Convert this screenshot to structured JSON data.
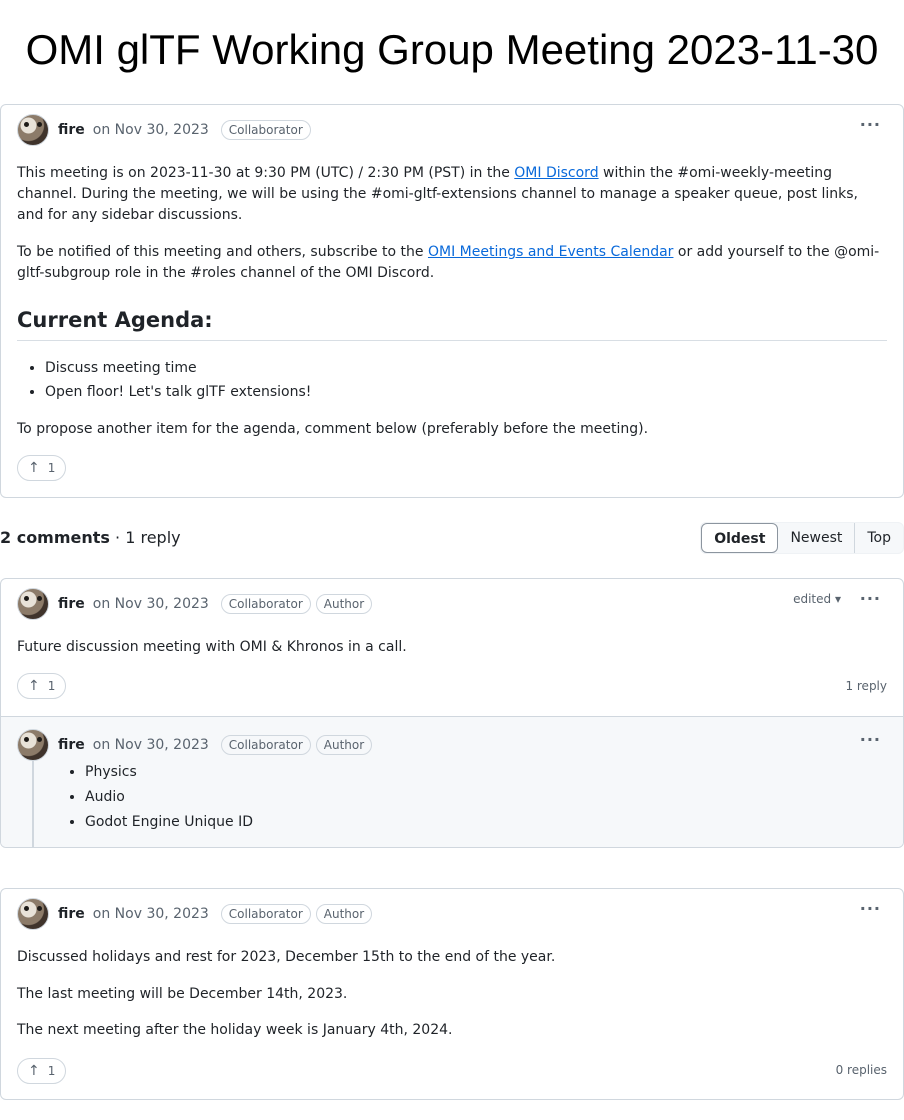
{
  "page_title": "OMI glTF Working Group Meeting 2023-11-30",
  "post": {
    "author": "fire",
    "date": "on Nov 30, 2023",
    "badge": "Collaborator",
    "para1_a": "This meeting is on 2023-11-30 at 9:30 PM (UTC) / 2:30 PM (PST) in the ",
    "para1_link": "OMI Discord",
    "para1_b": " within the #omi-weekly-meeting channel. During the meeting, we will be using the #omi-gltf-extensions channel to manage a speaker queue, post links, and for any sidebar discussions.",
    "para2_a": "To be notified of this meeting and others, subscribe to the ",
    "para2_link": "OMI Meetings and Events Calendar",
    "para2_b": " or add yourself to the @omi-gltf-subgroup role in the #roles channel of the OMI Discord.",
    "heading": "Current Agenda:",
    "agenda": [
      "Discuss meeting time",
      "Open floor! Let's talk glTF extensions!"
    ],
    "para3": "To propose another item for the agenda, comment below (preferably before the meeting).",
    "upvotes": "1"
  },
  "comments_header": {
    "count": "2 comments",
    "replies": " · 1 reply",
    "sort": [
      "Oldest",
      "Newest",
      "Top"
    ]
  },
  "comment1": {
    "author": "fire",
    "date": "on Nov 30, 2023",
    "badges": [
      "Collaborator",
      "Author"
    ],
    "edited": "edited",
    "body": "Future discussion meeting with OMI & Khronos in a call.",
    "upvotes": "1",
    "reply_count": "1 reply",
    "reply": {
      "author": "fire",
      "date": "on Nov 30, 2023",
      "badges": [
        "Collaborator",
        "Author"
      ],
      "items": [
        "Physics",
        "Audio",
        "Godot Engine Unique ID"
      ]
    }
  },
  "comment2": {
    "author": "fire",
    "date": "on Nov 30, 2023",
    "badges": [
      "Collaborator",
      "Author"
    ],
    "lines": [
      "Discussed holidays and rest for 2023, December 15th to the end of the year.",
      "The last meeting will be December 14th, 2023.",
      "The next meeting after the holiday week is January 4th, 2024."
    ],
    "upvotes": "1",
    "reply_count": "0 replies"
  },
  "icons": {
    "more": "kebab-horizontal-icon",
    "upvote": "arrow-up-icon",
    "caret": "triangle-down-icon"
  }
}
